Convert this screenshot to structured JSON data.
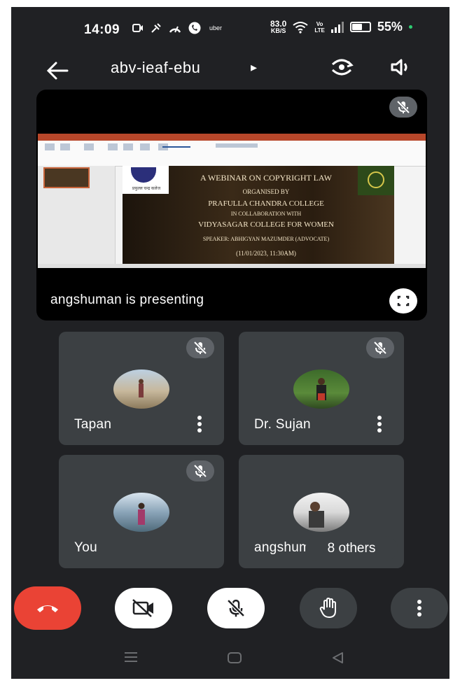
{
  "status_bar": {
    "time": "14:09",
    "app_icons": [
      "screen-record-icon",
      "tool-icon",
      "speed-icon",
      "phone-icon"
    ],
    "uber": "uber",
    "speed_value": "83.0",
    "speed_unit": "KB/S",
    "volte_top": "Vo",
    "volte_bottom": "LTE",
    "battery_percent": "55%",
    "battery_level": 0.55
  },
  "top_bar": {
    "meeting_code": "abv-ieaf-ebu",
    "caret": "▸"
  },
  "presentation": {
    "presenting_text": "angshuman is presenting",
    "slide": {
      "logo_caption": "प्रफुल्ल चन्द्र कलेज",
      "lines": [
        "A WEBINAR ON COPYRIGHT LAW",
        "ORGANISED BY",
        "PRAFULLA CHANDRA COLLEGE",
        "IN COLLABORATION WITH",
        "VIDYASAGAR COLLEGE FOR WOMEN",
        "SPEAKER: ABHIGYAN MAZUMDER (ADVOCATE)",
        "(11/01/2023, 11:30AM)"
      ]
    }
  },
  "participants": [
    {
      "name": "Tapan",
      "muted": true
    },
    {
      "name": "Dr. Sujan",
      "muted": true
    },
    {
      "name": "You",
      "muted": true
    },
    {
      "name": "angshuman",
      "muted": false
    }
  ],
  "others_label": "8 others",
  "controls": {
    "colors": {
      "end_call": "#ea4335",
      "light_button": "#ffffff",
      "dark_button": "#3c4043"
    }
  }
}
